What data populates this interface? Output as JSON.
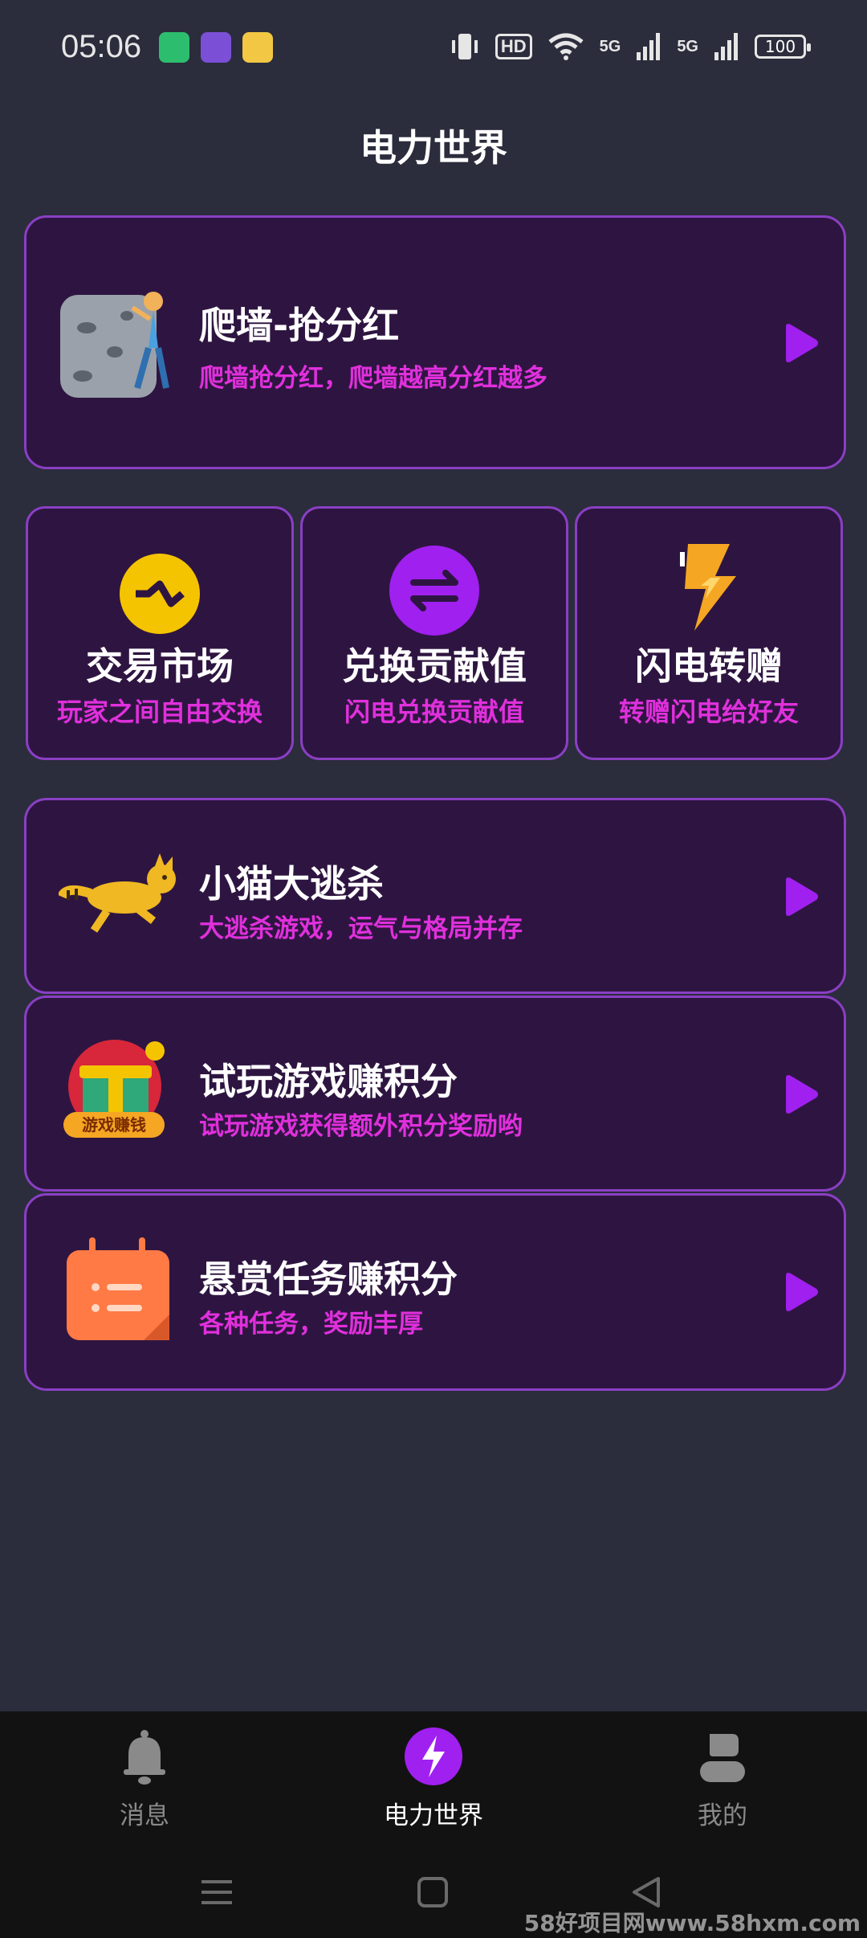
{
  "status_bar": {
    "time": "05:06",
    "hd_badge": "HD",
    "signal_1": "5G",
    "signal_2": "5G",
    "battery": "100"
  },
  "page": {
    "title": "电力世界"
  },
  "cards": {
    "climb": {
      "title": "爬墙-抢分红",
      "subtitle": "爬墙抢分红，爬墙越高分红越多"
    },
    "cat": {
      "title": "小猫大逃杀",
      "subtitle": "大逃杀游戏，运气与格局并存"
    },
    "trial": {
      "title": "试玩游戏赚积分",
      "subtitle": "试玩游戏获得额外积分奖励哟",
      "badge": "游戏赚钱"
    },
    "bounty": {
      "title": "悬赏任务赚积分",
      "subtitle": "各种任务，奖励丰厚"
    }
  },
  "tiles": [
    {
      "title": "交易市场",
      "subtitle": "玩家之间自由交换"
    },
    {
      "title": "兑换贡献值",
      "subtitle": "闪电兑换贡献值"
    },
    {
      "title": "闪电转赠",
      "subtitle": "转赠闪电给好友"
    }
  ],
  "bottom_nav": {
    "messages": "消息",
    "power_world": "电力世界",
    "mine": "我的",
    "active": "power_world"
  },
  "watermark": "58好项目网www.58hxm.com",
  "colors": {
    "background": "#2b2c3c",
    "card_bg": "#2e1541",
    "card_border": "#8a3fc4",
    "subtitle": "#e030dc",
    "play_button": "#a020f0",
    "nav_bg": "#121212"
  },
  "icons": {
    "climb": "rock-climber-icon",
    "market": "exchange-market-icon",
    "exchange": "swap-arrows-icon",
    "transfer": "lightning-bolt-icon",
    "cat": "running-cat-icon",
    "trial": "gift-box-icon",
    "bounty": "calendar-task-icon",
    "messages": "bell-icon",
    "power_world": "lightning-bolt-icon",
    "mine": "user-icon"
  }
}
